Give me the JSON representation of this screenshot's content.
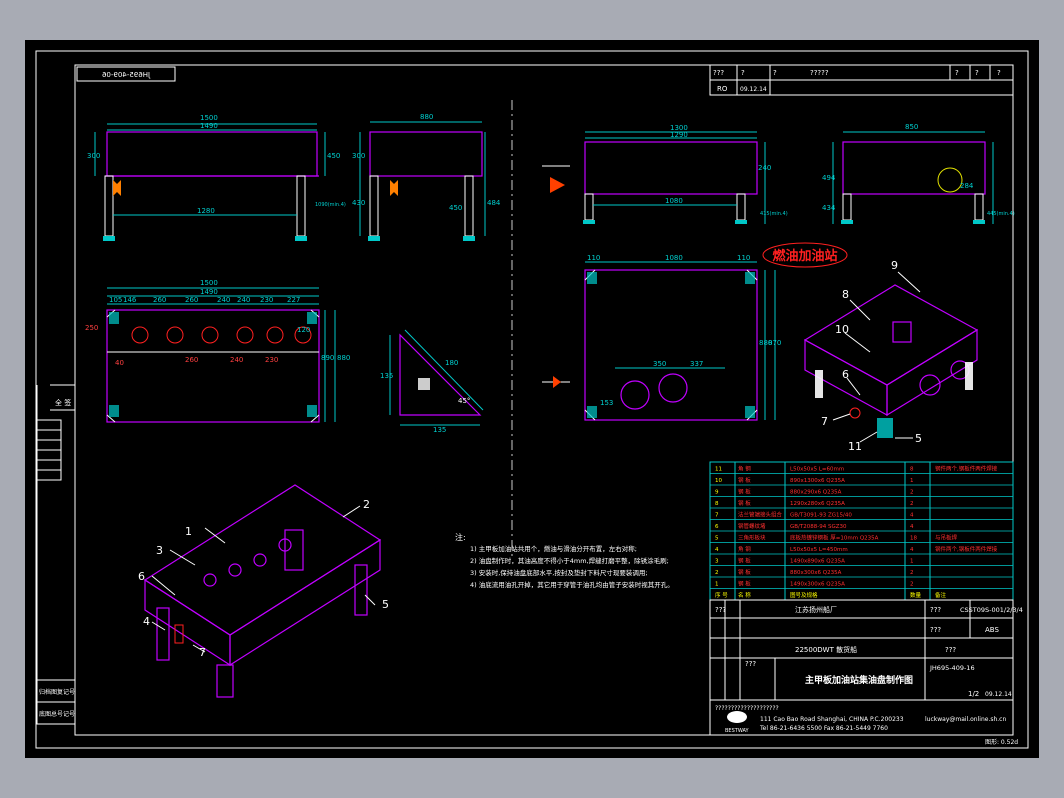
{
  "drawing": {
    "mirrored_number": "JH695-409-06",
    "station_label": "燃油加油站",
    "side_labels": [
      "全  签",
      "归档图复记号",
      "底图总号记号"
    ],
    "scale_note": "图形: 0.52d"
  },
  "revision_table": {
    "headers": [
      "???",
      "?",
      "?",
      "?????",
      "?",
      "?",
      "?"
    ],
    "row": [
      "RO",
      "09.12.14"
    ]
  },
  "dimensions": {
    "front": [
      "1500",
      "1490",
      "1280",
      "300",
      "450"
    ],
    "side": [
      "880",
      "300",
      "430",
      "450",
      "484",
      "1090(min.4)"
    ],
    "plan": [
      "1500",
      "1490",
      "105",
      "146",
      "260",
      "260",
      "240",
      "240",
      "230",
      "227",
      "250",
      "120",
      "40",
      "260",
      "240",
      "230",
      "890",
      "880"
    ],
    "gusset": [
      "135",
      "180",
      "45°",
      "135"
    ],
    "r_front": [
      "1300",
      "1290",
      "1080",
      "240",
      "415(min.4)"
    ],
    "r_side": [
      "850",
      "494",
      "434",
      "284",
      "445(min.4)"
    ],
    "r_plan": [
      "110",
      "1080",
      "110",
      "350",
      "337",
      "880",
      "870",
      "153"
    ]
  },
  "callouts_iso_right": [
    "9",
    "8",
    "10",
    "6",
    "7",
    "11",
    "5"
  ],
  "callouts_iso_left": [
    "1",
    "2",
    "3",
    "6",
    "4",
    "7",
    "5"
  ],
  "notes": {
    "title": "注:",
    "lines": [
      "1) 主甲板加油站共用个，燃油与滑油分开布置，左右对称;",
      "2) 油盘制作时，其油高度不得小于4mm,焊缝打磨平整，除锈涂毛刷;",
      "3) 安装时,保持油盘底部水平,按封及垫封下料尺寸现要装调用;",
      "4) 油底流用油孔开掉，其它用于穿管于油孔均由管子安装时视其开孔。"
    ]
  },
  "parts_list": {
    "rows": [
      [
        "11",
        "角 钢",
        "L50x50x5 L=60mm",
        "8",
        "钢件两个,钢板件两件焊接"
      ],
      [
        "10",
        "钢 板",
        "890x1300x6  Q235A",
        "1",
        ""
      ],
      [
        "9",
        "钢 板",
        "880x290x6  Q235A",
        "2",
        ""
      ],
      [
        "8",
        "钢 板",
        "1290x280x6  Q235A",
        "2",
        ""
      ],
      [
        "7",
        "法兰管端接头组合",
        "GB/T3091-93  ZG15/40",
        "4",
        ""
      ],
      [
        "6",
        "钢管螺纹堵",
        "GB/T2088-94 SGZ30",
        "4",
        ""
      ],
      [
        "5",
        "三角形板块",
        "底板热镀锌钢板 厚=10mm Q235A",
        "18",
        "与吊板焊"
      ],
      [
        "4",
        "角 钢",
        "L50x50x5 L=450mm",
        "4",
        "钢件两个,钢板件两件焊接"
      ],
      [
        "3",
        "钢 板",
        "1490x890x6  Q235A",
        "1",
        ""
      ],
      [
        "2",
        "钢 板",
        "880x300x6  Q235A",
        "2",
        ""
      ],
      [
        "1",
        "钢 板",
        "1490x300x6  Q235A",
        "2",
        ""
      ]
    ],
    "header": [
      "序 号",
      "名 称",
      "图号及规格",
      "数量",
      "备注"
    ]
  },
  "title_block": {
    "factory": "江苏扬州船厂",
    "code": "CSST09S-001/2/3/4",
    "society": "ABS",
    "ship": "22500DWT 散货船",
    "drawing_no": "JH695-409-16",
    "drawing_title": "主甲板加油站集油盘制作图",
    "sheet": "1/2",
    "date": "09.12.14",
    "company_logo_text": "BESTWAY",
    "address": "111 Cao Bao Road Shanghai, CHINA   P.C.200233",
    "tel": "Tel 86-21-6436 5500  Fax 86-21-5449 7760",
    "email": "luckway@mail.online.sh.cn",
    "unknown_marks": "???",
    "placeholder_row": "????????????????????"
  },
  "colors": {
    "background": "#000000",
    "frame": "#ffffff",
    "magenta": "#c000ff",
    "cyan": "#00c8c8",
    "red": "#ff2020",
    "yellow": "#f0f000"
  }
}
